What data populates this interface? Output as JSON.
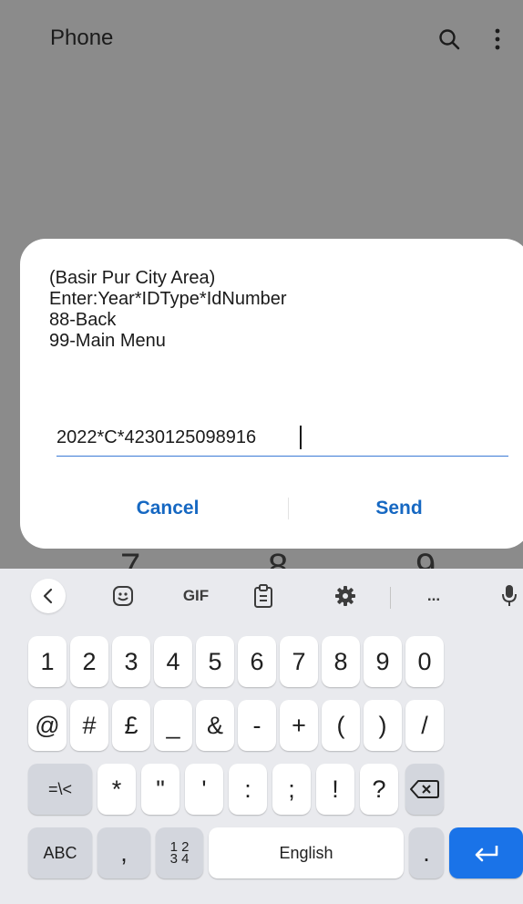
{
  "app": {
    "title": "Phone"
  },
  "dialpad_peek": [
    "7",
    "8",
    "9"
  ],
  "dialog": {
    "lines": [
      "(Basir Pur City Area)",
      "Enter:Year*IDType*IdNumber",
      "88-Back",
      "99-Main Menu"
    ],
    "input_value": "2022*C*4230125098916",
    "cancel_label": "Cancel",
    "send_label": "Send"
  },
  "keyboard": {
    "toolbar": {
      "gif_label": "GIF",
      "more_label": "..."
    },
    "row_numbers": [
      "1",
      "2",
      "3",
      "4",
      "5",
      "6",
      "7",
      "8",
      "9",
      "0"
    ],
    "row_symbols1": [
      "@",
      "#",
      "£",
      "_",
      "&",
      "-",
      "+",
      "(",
      ")",
      "/"
    ],
    "row_symbols2": [
      "*",
      "\"",
      "'",
      ":",
      ";",
      "!",
      "?"
    ],
    "row2_fn_label": "=\\<",
    "abc_label": "ABC",
    "comma_label": ",",
    "numpad_top": "1 2",
    "numpad_bottom": "3 4",
    "space_label": "English",
    "period_label": "."
  },
  "colors": {
    "accent": "#1668c2",
    "enter_key": "#1a73e8",
    "dim_background": "#8b8b8b"
  }
}
